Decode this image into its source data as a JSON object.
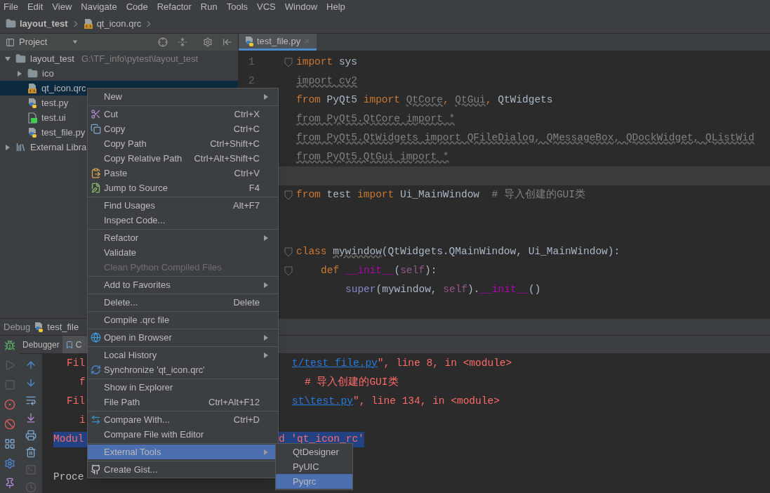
{
  "menu_bar": [
    "File",
    "Edit",
    "View",
    "Navigate",
    "Code",
    "Refactor",
    "Run",
    "Tools",
    "VCS",
    "Window",
    "Help"
  ],
  "breadcrumb": [
    {
      "label": "layout_test",
      "kind": "folder"
    },
    {
      "label": "qt_icon.qrc",
      "kind": "qrc"
    }
  ],
  "project_panel": {
    "title": "Project",
    "tree": [
      {
        "label": "layout_test",
        "path": "G:\\TF_info\\pytest\\layout_test",
        "kind": "folder",
        "expanded": true,
        "selected": false,
        "children": [
          {
            "label": "ico",
            "kind": "folder",
            "expanded": false,
            "selected": false
          },
          {
            "label": "qt_icon.qrc",
            "kind": "qrc",
            "selected": true
          },
          {
            "label": "test.py",
            "kind": "py",
            "selected": false
          },
          {
            "label": "test.ui",
            "kind": "ui",
            "selected": false
          },
          {
            "label": "test_file.py",
            "kind": "py",
            "selected": false
          }
        ]
      },
      {
        "label": "External Libra",
        "kind": "library",
        "expanded": false,
        "selected": false
      }
    ]
  },
  "editor": {
    "tabs": [
      {
        "label": "test_file.py",
        "selected": true
      }
    ],
    "lines": [
      {
        "number": "1",
        "kind": "top",
        "fold": true,
        "current": false,
        "tokens": [
          {
            "text": "import ",
            "kind": "kw"
          },
          {
            "text": "sys",
            "kind": "plain"
          }
        ]
      },
      {
        "number": "2",
        "kind": "top",
        "fold": false,
        "current": false,
        "tokens": [
          {
            "text": "import cv2",
            "kind": "unused"
          }
        ]
      },
      {
        "kind": "top",
        "fold": false,
        "current": false,
        "tokens": [
          {
            "text": "from ",
            "kind": "kw"
          },
          {
            "text": "PyQt5 ",
            "kind": "plain"
          },
          {
            "text": "import ",
            "kind": "kw"
          },
          {
            "text": "QtCore",
            "kind": "unused"
          },
          {
            "text": ", ",
            "kind": "kw"
          },
          {
            "text": "QtGui",
            "kind": "unused"
          },
          {
            "text": ", ",
            "kind": "kw"
          },
          {
            "text": "QtWidgets",
            "kind": "plain"
          }
        ]
      },
      {
        "kind": "top",
        "fold": false,
        "current": false,
        "tokens": [
          {
            "text": "from PyQt5.QtCore import *",
            "kind": "unused"
          }
        ]
      },
      {
        "kind": "top",
        "fold": false,
        "current": false,
        "tokens": [
          {
            "text": "from PyQt5.QtWidgets import QFileDialog, QMessageBox, QDockWidget, QListWid",
            "kind": "unused"
          }
        ]
      },
      {
        "kind": "top",
        "fold": false,
        "current": false,
        "tokens": [
          {
            "text": "from PyQt5.QtGui import *",
            "kind": "unused"
          }
        ]
      },
      {
        "fold": false,
        "current": true
      },
      {
        "kind": "top",
        "fold": true,
        "current": false,
        "tokens": [
          {
            "text": "from ",
            "kind": "kw"
          },
          {
            "text": "test ",
            "kind": "plain"
          },
          {
            "text": "import ",
            "kind": "kw"
          },
          {
            "text": "Ui_MainWindow  ",
            "kind": "plain"
          },
          {
            "text": "# 导入创建的GUI类",
            "kind": "comment"
          }
        ]
      },
      {
        "fold": false,
        "current": false
      },
      {
        "fold": false,
        "current": false
      },
      {
        "kind": "top",
        "fold": true,
        "current": false,
        "tokens": [
          {
            "text": "class ",
            "kind": "kw"
          },
          {
            "text": "mywindow",
            "kind": "warn"
          },
          {
            "text": "(QtWidgets.QMainWindow, Ui_MainWindow):",
            "kind": "plain"
          }
        ]
      },
      {
        "kind": "def",
        "fold": true,
        "current": false,
        "tokens": [
          {
            "text": "def ",
            "kind": "kw"
          },
          {
            "text": "__init__",
            "kind": "magic"
          },
          {
            "text": "(",
            "kind": "plain"
          },
          {
            "text": "self",
            "kind": "self"
          },
          {
            "text": "):",
            "kind": "plain"
          }
        ]
      },
      {
        "kind": "stmt",
        "fold": false,
        "current": false,
        "tokens": [
          {
            "text": "super",
            "kind": "builtin"
          },
          {
            "text": "(mywindow, ",
            "kind": "plain"
          },
          {
            "text": "self",
            "kind": "self"
          },
          {
            "text": ").",
            "kind": "plain"
          },
          {
            "text": "__init__",
            "kind": "magic"
          },
          {
            "text": "()",
            "kind": "plain"
          }
        ]
      }
    ]
  },
  "debug_panel": {
    "title": "Debug",
    "config": "test_file",
    "tabs": [
      {
        "label": "Debugger",
        "selected": false
      },
      {
        "label": "C",
        "selected": true
      }
    ],
    "console": [
      {
        "kind": "frame",
        "left": "Fil",
        "right": [
          {
            "text": "t/test_file.py",
            "kind": "link"
          },
          {
            "text": "\", line 8, in <module>",
            "kind": "err"
          }
        ]
      },
      {
        "kind": "source",
        "left": "f",
        "right": [
          {
            "text": "# 导入创建的GUI类",
            "kind": "err"
          }
        ]
      },
      {
        "kind": "frame",
        "left": "Fil",
        "right": [
          {
            "text": "st\\test.py",
            "kind": "link"
          },
          {
            "text": "\", line 134, in <module>",
            "kind": "err"
          }
        ]
      },
      {
        "kind": "source",
        "left": "i"
      },
      {
        "kind": "error",
        "left": "Modul",
        "right": [
          {
            "text": "d 'qt_icon_rc'",
            "kind": "err"
          }
        ]
      },
      {
        "kind": "blank"
      },
      {
        "kind": "plain",
        "left": "Proce"
      }
    ]
  },
  "context_menu": {
    "sections": [
      [
        {
          "label": "New",
          "submenu": true,
          "disabled": false,
          "selected": false,
          "kind": "plain"
        }
      ],
      [
        {
          "label": "Cut",
          "shortcut": "Ctrl+X",
          "submenu": false,
          "disabled": false,
          "selected": false,
          "kind": "cut"
        },
        {
          "label": "Copy",
          "shortcut": "Ctrl+C",
          "submenu": false,
          "disabled": false,
          "selected": false,
          "kind": "copy"
        },
        {
          "label": "Copy Path",
          "shortcut": "Ctrl+Shift+C",
          "submenu": false,
          "disabled": false,
          "selected": false,
          "kind": "plain"
        },
        {
          "label": "Copy Relative Path",
          "shortcut": "Ctrl+Alt+Shift+C",
          "submenu": false,
          "disabled": false,
          "selected": false,
          "kind": "plain"
        },
        {
          "label": "Paste",
          "shortcut": "Ctrl+V",
          "submenu": false,
          "disabled": false,
          "selected": false,
          "kind": "paste"
        },
        {
          "label": "Jump to Source",
          "shortcut": "F4",
          "submenu": false,
          "disabled": false,
          "selected": false,
          "kind": "jump"
        }
      ],
      [
        {
          "label": "Find Usages",
          "shortcut": "Alt+F7",
          "submenu": false,
          "disabled": false,
          "selected": false,
          "kind": "plain"
        },
        {
          "label": "Inspect Code...",
          "submenu": false,
          "disabled": false,
          "selected": false,
          "kind": "plain"
        }
      ],
      [
        {
          "label": "Refactor",
          "submenu": true,
          "disabled": false,
          "selected": false,
          "kind": "plain"
        },
        {
          "label": "Validate",
          "submenu": false,
          "disabled": false,
          "selected": false,
          "kind": "plain"
        },
        {
          "label": "Clean Python Compiled Files",
          "submenu": false,
          "disabled": true,
          "selected": false,
          "kind": "plain"
        }
      ],
      [
        {
          "label": "Add to Favorites",
          "submenu": true,
          "disabled": false,
          "selected": false,
          "kind": "plain"
        }
      ],
      [
        {
          "label": "Delete...",
          "shortcut": "Delete",
          "submenu": false,
          "disabled": false,
          "selected": false,
          "kind": "plain"
        }
      ],
      [
        {
          "label": "Compile .qrc file",
          "submenu": false,
          "disabled": false,
          "selected": false,
          "kind": "plain"
        }
      ],
      [
        {
          "label": "Open in Browser",
          "submenu": true,
          "disabled": false,
          "selected": false,
          "kind": "browser"
        }
      ],
      [
        {
          "label": "Local History",
          "submenu": true,
          "disabled": false,
          "selected": false,
          "kind": "plain"
        },
        {
          "label": "Synchronize 'qt_icon.qrc'",
          "submenu": false,
          "disabled": false,
          "selected": false,
          "kind": "sync"
        }
      ],
      [
        {
          "label": "Show in Explorer",
          "submenu": false,
          "disabled": false,
          "selected": false,
          "kind": "plain"
        },
        {
          "label": "File Path",
          "shortcut": "Ctrl+Alt+F12",
          "submenu": false,
          "disabled": false,
          "selected": false,
          "kind": "plain"
        }
      ],
      [
        {
          "label": "Compare With...",
          "shortcut": "Ctrl+D",
          "submenu": false,
          "disabled": false,
          "selected": false,
          "kind": "compare"
        },
        {
          "label": "Compare File with Editor",
          "submenu": false,
          "disabled": false,
          "selected": false,
          "kind": "plain"
        }
      ],
      [
        {
          "label": "External Tools",
          "submenu": true,
          "disabled": false,
          "selected": true,
          "kind": "plain"
        }
      ],
      [
        {
          "label": "Create Gist...",
          "submenu": false,
          "disabled": false,
          "selected": false,
          "kind": "gist"
        }
      ]
    ]
  },
  "submenu": [
    {
      "label": "QtDesigner",
      "selected": false
    },
    {
      "label": "PyUIC",
      "selected": false
    },
    {
      "label": "Pyqrc",
      "selected": true
    }
  ]
}
